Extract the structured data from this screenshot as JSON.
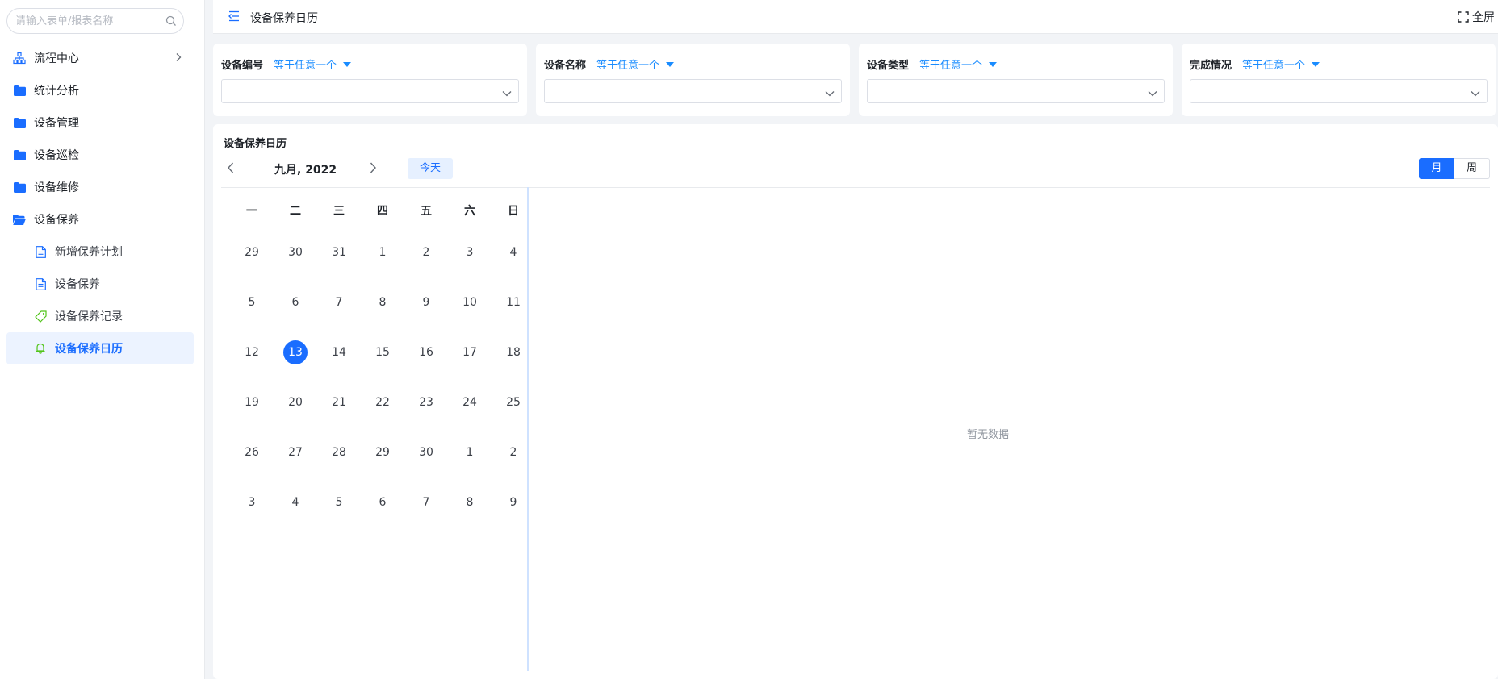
{
  "sidebar": {
    "search": {
      "placeholder": "请输入表单/报表名称",
      "value": ""
    },
    "items": [
      {
        "label": "流程中心"
      },
      {
        "label": "统计分析"
      },
      {
        "label": "设备管理"
      },
      {
        "label": "设备巡检"
      },
      {
        "label": "设备维修"
      },
      {
        "label": "设备保养"
      }
    ],
    "sub_items": [
      {
        "label": "新增保养计划"
      },
      {
        "label": "设备保养"
      },
      {
        "label": "设备保养记录"
      },
      {
        "label": "设备保养日历"
      }
    ]
  },
  "topbar": {
    "title": "设备保养日历",
    "fullscreen_label": "全屏"
  },
  "filters": [
    {
      "label": "设备编号",
      "operator": "等于任意一个",
      "value": ""
    },
    {
      "label": "设备名称",
      "operator": "等于任意一个",
      "value": ""
    },
    {
      "label": "设备类型",
      "operator": "等于任意一个",
      "value": ""
    },
    {
      "label": "完成情况",
      "operator": "等于任意一个",
      "value": ""
    }
  ],
  "calendar": {
    "title": "设备保养日历",
    "month_label": "九月, 2022",
    "today_label": "今天",
    "views": {
      "month": "月",
      "week": "周"
    },
    "active_view": "月",
    "weekdays": [
      "一",
      "二",
      "三",
      "四",
      "五",
      "六",
      "日"
    ],
    "weeks": [
      [
        "29",
        "30",
        "31",
        "1",
        "2",
        "3",
        "4"
      ],
      [
        "5",
        "6",
        "7",
        "8",
        "9",
        "10",
        "11"
      ],
      [
        "12",
        "13",
        "14",
        "15",
        "16",
        "17",
        "18"
      ],
      [
        "19",
        "20",
        "21",
        "22",
        "23",
        "24",
        "25"
      ],
      [
        "26",
        "27",
        "28",
        "29",
        "30",
        "1",
        "2"
      ],
      [
        "3",
        "4",
        "5",
        "6",
        "7",
        "8",
        "9"
      ]
    ],
    "selected_day": "13",
    "empty_text": "暂无数据"
  },
  "colors": {
    "accent": "#1a6dff",
    "folder_icon": "#1a6dff",
    "tag_icon": "#52c41a",
    "bell_icon": "#52c41a",
    "operator_text": "#1a8cff"
  }
}
